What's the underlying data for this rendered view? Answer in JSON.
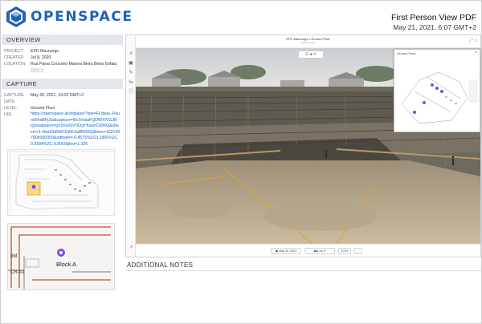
{
  "header": {
    "brand": "OPENSPACE",
    "doc_title": "First Person View PDF",
    "doc_date": "May 21, 2021, 6:07 GMT+2",
    "brand_color": "#1f63b6"
  },
  "overview": {
    "heading": "OVERVIEW",
    "rows": [
      {
        "label": "PROJECT",
        "value": "EPC Macrungo"
      },
      {
        "label": "CREATED",
        "value": "Jul 8, 2020"
      },
      {
        "label": "LOCATION",
        "value": "Rua Paiva Couceiro Marora Beira Beira Sofala ░░░ ░"
      }
    ]
  },
  "capture": {
    "heading": "CAPTURE",
    "rows": [
      {
        "label": "CAPTURE DATE",
        "value": "May 20, 2021, 10:03 GMT+2"
      },
      {
        "label": "LEVEL",
        "value": "Ground Floor"
      }
    ],
    "url_label": "URL",
    "url": "https://openspace.ai/ohplayer?site=FLdwaL-RsumbIhaBFjZw&capture=8eJVoaaFQDWXIVGJR-Qyvw&pano=gV1KwXIvTiOgYKaooClDRQ&sheet=v1-HwrGhRWCDAKJw8Rl32Q&time=1621497806000000&attitude=-0.4575%2C0.1866%2C0.3284%2C-0.8050&fov=1.326"
  },
  "floorplan": {
    "zoom_labels": [
      "3M",
      "CR-A1"
    ],
    "block_label": "Block A",
    "pin_color": "#7b4fd6"
  },
  "viewer": {
    "title": "EPC Macrungo • Ground Floor",
    "subtitle": "Capture view",
    "minimap_title": "Ground Floor",
    "bottom_date": "May 20, 2021",
    "bottom_time": "10:03",
    "toolbar_icons": [
      "list-icon",
      "zoom-icon",
      "tag-icon"
    ],
    "side_icons": [
      "layers-icon",
      "minimap-icon",
      "tools-icon",
      "compare-icon",
      "info-icon",
      "share-icon"
    ]
  },
  "notes": {
    "heading": "ADDITIONAL NOTES"
  }
}
